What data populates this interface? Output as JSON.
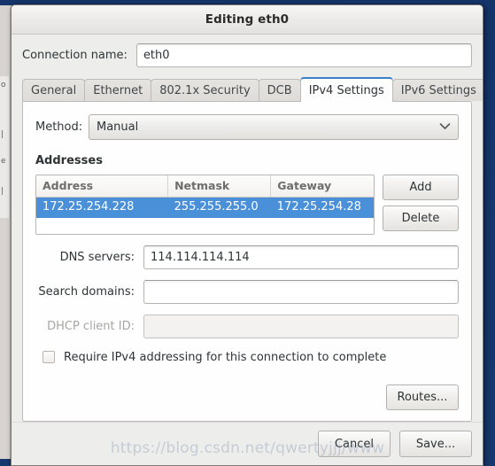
{
  "window": {
    "title": "Editing eth0"
  },
  "connection": {
    "label": "Connection name:",
    "value": "eth0"
  },
  "tabs": [
    {
      "label": "General",
      "active": false
    },
    {
      "label": "Ethernet",
      "active": false
    },
    {
      "label": "802.1x Security",
      "active": false
    },
    {
      "label": "DCB",
      "active": false
    },
    {
      "label": "IPv4 Settings",
      "active": true
    },
    {
      "label": "IPv6 Settings",
      "active": false
    }
  ],
  "method": {
    "label": "Method:",
    "value": "Manual",
    "chevron": "chevron-down-icon"
  },
  "addresses": {
    "heading": "Addresses",
    "columns": [
      "Address",
      "Netmask",
      "Gateway"
    ],
    "rows": [
      {
        "address": "172.25.254.228",
        "netmask": "255.255.255.0",
        "gateway": "172.25.254.28",
        "selected": true
      }
    ],
    "add_label": "Add",
    "delete_label": "Delete"
  },
  "fields": {
    "dns": {
      "label": "DNS servers:",
      "value": "114.114.114.114",
      "disabled": false
    },
    "search_domains": {
      "label": "Search domains:",
      "value": "",
      "disabled": false
    },
    "dhcp_client_id": {
      "label": "DHCP client ID:",
      "value": "",
      "disabled": true
    }
  },
  "require_ipv4": {
    "label": "Require IPv4 addressing for this connection to complete",
    "checked": false
  },
  "routes": {
    "label": "Routes..."
  },
  "actions": {
    "cancel": "Cancel",
    "save": "Save..."
  },
  "watermark": {
    "text": "https://blog.csdn.net/qwertyjjj/www"
  },
  "colors": {
    "selection_blue": "#4a90d9",
    "active_tab_border": "#3b7fc4",
    "desktop_backdrop": "#15356a",
    "dialog_bg": "#ededeb"
  }
}
